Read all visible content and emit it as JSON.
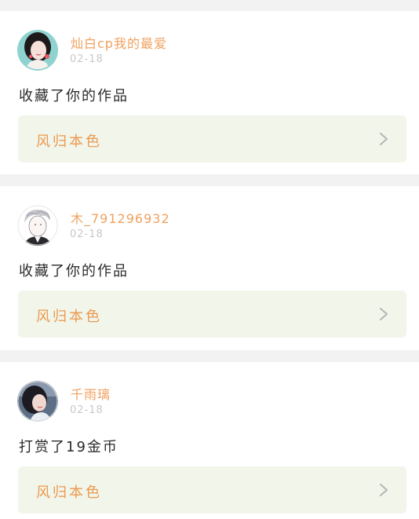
{
  "feed": {
    "items": [
      {
        "username": "灿白cp我的最爱",
        "time": "02-18",
        "action": "收藏了你的作品",
        "work_title": "风归本色",
        "avatar_icon": "user-avatar-icon"
      },
      {
        "username": "木_791296932",
        "time": "02-18",
        "action": "收藏了你的作品",
        "work_title": "风归本色",
        "avatar_icon": "user-avatar-icon"
      },
      {
        "username": "千雨璃",
        "time": "02-18",
        "action": "打赏了19金币",
        "work_title": "风归本色",
        "avatar_icon": "user-avatar-icon"
      }
    ]
  },
  "colors": {
    "page_background": "#f2f2f2",
    "card_background": "#ffffff",
    "username": "#f0a15f",
    "time": "#c8c8c8",
    "action_text": "#2b2b2b",
    "work_link_background": "#f1f5ea",
    "work_title": "#ec9a50",
    "chevron": "#b5b5b5"
  }
}
